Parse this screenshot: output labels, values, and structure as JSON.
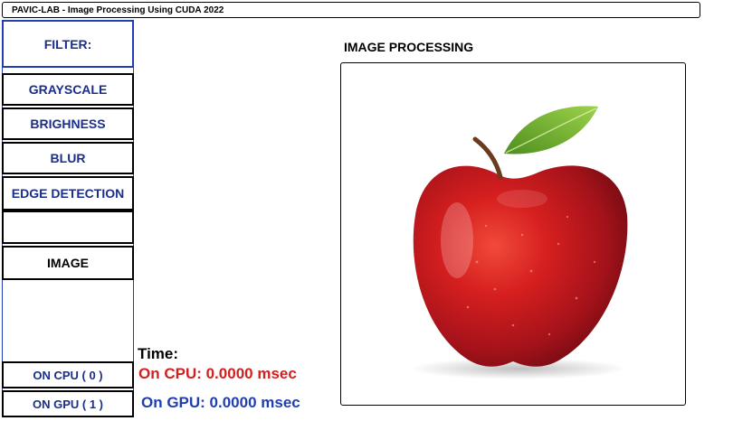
{
  "window": {
    "title": "PAVIC-LAB - Image Processing Using CUDA 2022"
  },
  "sidebar": {
    "filter_label": "FILTER:",
    "grayscale_label": "GRAYSCALE",
    "brightness_label": "BRIGHNESS",
    "blur_label": "BLUR",
    "edge_label": "EDGE DETECTION",
    "empty_label": "",
    "image_label": "IMAGE",
    "cpu_label": "ON CPU ( 0 )",
    "gpu_label": "ON GPU ( 1 )"
  },
  "timing": {
    "label": "Time:",
    "cpu": "On CPU: 0.0000 msec",
    "gpu": "On GPU: 0.0000 msec"
  },
  "panel": {
    "title": "IMAGE PROCESSING",
    "image_subject": "red-apple-icon"
  },
  "colors": {
    "accent_blue": "#1f3fb0",
    "label_navy": "#1a2e8c",
    "cpu_red": "#d12020"
  }
}
